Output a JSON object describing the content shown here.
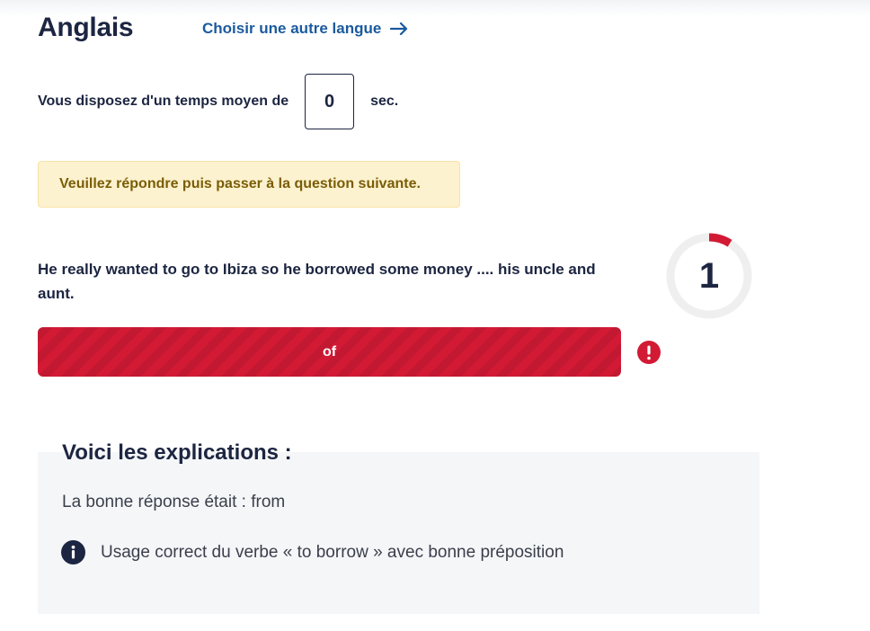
{
  "header": {
    "title": "Anglais",
    "change_language_label": "Choisir une autre langue",
    "change_language_icon": "arrow-right-icon"
  },
  "timer": {
    "prefix": "Vous disposez d'un temps moyen de",
    "value": "0",
    "suffix": "sec."
  },
  "notice": {
    "text": "Veuillez répondre puis passer à la question suivante."
  },
  "question": {
    "text": "He really wanted to go to Ibiza so he borrowed some money .... his uncle and aunt.",
    "number": "1",
    "progress_fraction": 0.09
  },
  "answer": {
    "selected_label": "of",
    "status_icon": "exclamation-icon"
  },
  "explanation": {
    "title": "Voici les explications :",
    "correct_answer": "La bonne réponse était : from",
    "info_icon": "info-icon",
    "info_text": "Usage correct du verbe « to borrow » avec bonne préposition"
  },
  "colors": {
    "primary_text": "#1c2541",
    "link": "#1a5a9e",
    "wrong_answer": "#d21a35",
    "warning_bg": "#fdf2cf",
    "warning_text": "#7a5d06",
    "explain_bg": "#f5f6f8"
  }
}
